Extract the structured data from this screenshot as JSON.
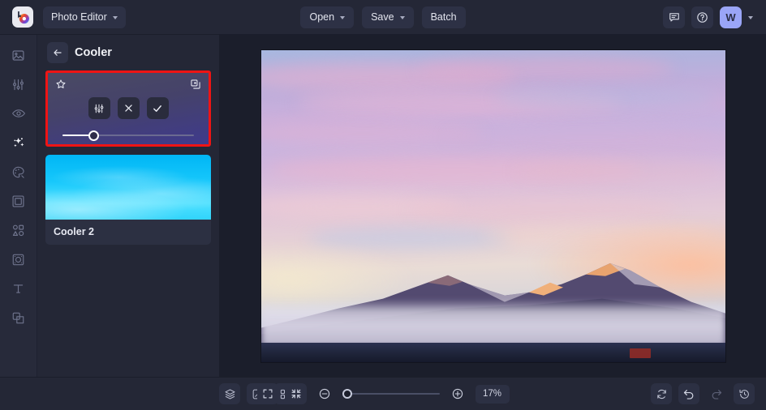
{
  "topbar": {
    "logo_icon": "rainbow-circle-logo",
    "app_menu": {
      "label": "Photo Editor",
      "icon": "chevron-down-icon"
    },
    "buttons": [
      {
        "label": "Open",
        "name": "open-button",
        "has_chevron": true
      },
      {
        "label": "Save",
        "name": "save-button",
        "has_chevron": true
      },
      {
        "label": "Batch",
        "name": "batch-button",
        "has_chevron": false
      }
    ],
    "right": {
      "feedback_icon": "chat-bubble-icon",
      "help_icon": "question-circle-icon",
      "avatar_initial": "W",
      "avatar_color": "#9aa5f7",
      "account_chevron_icon": "chevron-down-icon"
    }
  },
  "rail": {
    "items": [
      {
        "name": "sidebar-item-image",
        "icon": "image-icon",
        "active": false
      },
      {
        "name": "sidebar-item-adjust",
        "icon": "sliders-icon",
        "active": false
      },
      {
        "name": "sidebar-item-retouch",
        "icon": "eye-icon",
        "active": false
      },
      {
        "name": "sidebar-item-effects",
        "icon": "sparkles-icon",
        "active": true
      },
      {
        "name": "sidebar-item-color",
        "icon": "palette-icon",
        "active": false
      },
      {
        "name": "sidebar-item-frames",
        "icon": "frame-icon",
        "active": false
      },
      {
        "name": "sidebar-item-shapes",
        "icon": "shapes-icon",
        "active": false
      },
      {
        "name": "sidebar-item-stickers",
        "icon": "sticker-icon",
        "active": false
      },
      {
        "name": "sidebar-item-text",
        "icon": "text-t-icon",
        "active": false
      },
      {
        "name": "sidebar-item-overlays",
        "icon": "layers-overlay-icon",
        "active": false
      }
    ]
  },
  "panel": {
    "back_icon": "arrow-left-icon",
    "title": "Cooler",
    "selected_card": {
      "name": "preset-card-cooler",
      "highlight_color": "#ef1414",
      "favorite_icon": "star-icon",
      "duplicate_icon": "duplicate-icon",
      "actions": [
        {
          "name": "adjust-effect-button",
          "icon": "sliders-icon"
        },
        {
          "name": "remove-effect-button",
          "icon": "close-x-icon"
        },
        {
          "name": "apply-effect-button",
          "icon": "check-icon"
        }
      ],
      "slider": {
        "name": "effect-strength-slider",
        "value": 20
      }
    },
    "cards": [
      {
        "name": "preset-card-cooler-2",
        "label": "Cooler 2",
        "thumbnail": "cyan-sky-thumbnail"
      }
    ]
  },
  "canvas": {
    "image_alt": "pastel sunset sky over mountain range with low fog"
  },
  "bottombar": {
    "left": [
      {
        "name": "layers-button",
        "icon": "layers-icon"
      },
      {
        "name": "compare-button",
        "icon": "compare-split-icon"
      },
      {
        "name": "grid-button",
        "icon": "grid-icon"
      }
    ],
    "view": [
      {
        "name": "fit-to-screen-button",
        "icon": "expand-corners-icon"
      },
      {
        "name": "shrink-view-button",
        "icon": "collapse-corners-icon"
      }
    ],
    "zoom": {
      "out_icon": "zoom-out-icon",
      "in_icon": "zoom-in-icon",
      "slider_name": "zoom-slider",
      "level": "17%",
      "slider_value": 0
    },
    "right": [
      {
        "name": "reset-button",
        "icon": "reset-refresh-icon",
        "disabled": false
      },
      {
        "name": "undo-button",
        "icon": "undo-arrow-icon",
        "disabled": false
      },
      {
        "name": "redo-button",
        "icon": "redo-arrow-icon",
        "disabled": true
      },
      {
        "name": "history-button",
        "icon": "history-clock-icon",
        "disabled": false
      }
    ]
  }
}
